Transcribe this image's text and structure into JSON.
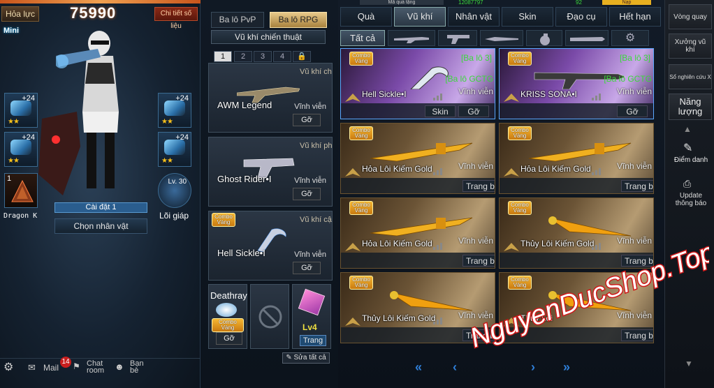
{
  "left": {
    "hoa_luc_label": "Hỏa lực",
    "hoa_luc_value": "75990",
    "detail_btn": "Chi tiết số liệu",
    "mini": "Mini",
    "slots_left": [
      {
        "lv": "+24",
        "stars": "★★",
        "icon": "helmet-icon"
      },
      {
        "lv": "+24",
        "stars": "★★",
        "icon": "armor-icon"
      },
      {
        "lv": "1",
        "stars": "",
        "icon": "pyramid-icon"
      }
    ],
    "slots_right": [
      {
        "lv": "+24",
        "stars": "★★",
        "icon": "goggles-icon"
      },
      {
        "lv": "+24",
        "stars": "★★",
        "icon": "jetpack-icon"
      },
      {
        "lv": "Lv. 30",
        "stars": "",
        "icon": "core-icon"
      }
    ],
    "setup": "Cài đặt 1",
    "choose_char": "Chọn nhân vật",
    "dragon_label": "Dragon K",
    "armor_label": "Lõi giáp",
    "bottom": {
      "mail": "Mail",
      "mail_count": "14",
      "chat": "Chat room",
      "friends": "Bạn bè"
    }
  },
  "middle": {
    "tab_pvp": "Ba lô PvP",
    "tab_rpg": "Ba lô RPG",
    "subtitle": "Vũ khí chiến thuật",
    "pages": [
      "1",
      "2",
      "3",
      "4"
    ],
    "loadouts": [
      {
        "slot": "Vũ khí chín",
        "name": "AWM Legend",
        "dur": "Vĩnh viễn",
        "btn": "Gỡ",
        "combo": ""
      },
      {
        "slot": "Vũ khí phụ",
        "name": "Ghost Rider•I",
        "dur": "Vĩnh viễn",
        "btn": "Gỡ",
        "combo": ""
      },
      {
        "slot": "Vũ khí cận",
        "name": "Hell Sickle•I",
        "dur": "Vĩnh viễn",
        "btn": "Gỡ",
        "combo": "Combo Vàng"
      }
    ],
    "deathray": {
      "name": "Deathray",
      "combo": "Combo Vàng",
      "btn": "Gỡ"
    },
    "item": {
      "lv": "Lv4",
      "btn": "Trang"
    },
    "edit_all": "Sửa tất cả"
  },
  "nav": {
    "tabs": [
      "Quà",
      "Vũ khí",
      "Nhân vật",
      "Skin",
      "Đạo cụ",
      "Hết hạn"
    ],
    "top_partial": [
      "Mã quà tặng",
      "12087797",
      "92",
      "Nạp"
    ],
    "filter_all": "Tất cả"
  },
  "cards": [
    {
      "name": "Hell Sickle•I",
      "green1": "[Ba lô 3]",
      "green2": "[Ba lô GCTG",
      "dur": "Vĩnh viễn",
      "btns": [
        "Skin",
        "Gỡ"
      ],
      "selected": true,
      "combo": "Combo Vàng"
    },
    {
      "name": "KRISS SONA•I",
      "green1": "[Ba lô 3]",
      "green2": "[Ba lô GCTG",
      "dur": "Vĩnh viễn",
      "btns": [
        "Gỡ"
      ],
      "selected": true,
      "combo": "Combo Vàng"
    },
    {
      "name": "Hỏa Lôi Kiếm Gold",
      "green1": "",
      "green2": "",
      "dur": "Vĩnh viễn",
      "btns": [
        "Trang b"
      ],
      "selected": false,
      "combo": "Combo Vàng"
    },
    {
      "name": "Hỏa Lôi Kiếm Gold",
      "green1": "",
      "green2": "",
      "dur": "Vĩnh viễn",
      "btns": [
        "Trang b"
      ],
      "selected": false,
      "combo": "Combo Vàng"
    },
    {
      "name": "Hỏa Lôi Kiếm Gold",
      "green1": "",
      "green2": "",
      "dur": "Vĩnh viễn",
      "btns": [
        "Trang b"
      ],
      "selected": false,
      "combo": "Combo Vàng"
    },
    {
      "name": "Thủy Lôi Kiếm Gold",
      "green1": "",
      "green2": "",
      "dur": "Vĩnh viễn",
      "btns": [
        "Trang b"
      ],
      "selected": false,
      "combo": "Combo Vàng"
    },
    {
      "name": "Thủy Lôi Kiếm Gold",
      "green1": "",
      "green2": "",
      "dur": "Vĩnh viễn",
      "btns": [
        "Trang b"
      ],
      "selected": false,
      "combo": "Combo Vàng"
    },
    {
      "name": "Thủy Lôi",
      "green1": "",
      "green2": "",
      "dur": "Vĩnh viễn",
      "btns": [
        "Trang b"
      ],
      "selected": false,
      "combo": "Combo Vàng"
    }
  ],
  "pager": {
    "first": "«",
    "prev": "‹",
    "next": "›",
    "last": "»"
  },
  "far": {
    "items": [
      "Vòng quay",
      "Xưởng vũ khí",
      "Sổ nghiên cứu X",
      "Năng lượng"
    ],
    "fullname": "Điểm danh",
    "update": "Update thông báo"
  },
  "watermark": "NguyenDucShop.Top"
}
